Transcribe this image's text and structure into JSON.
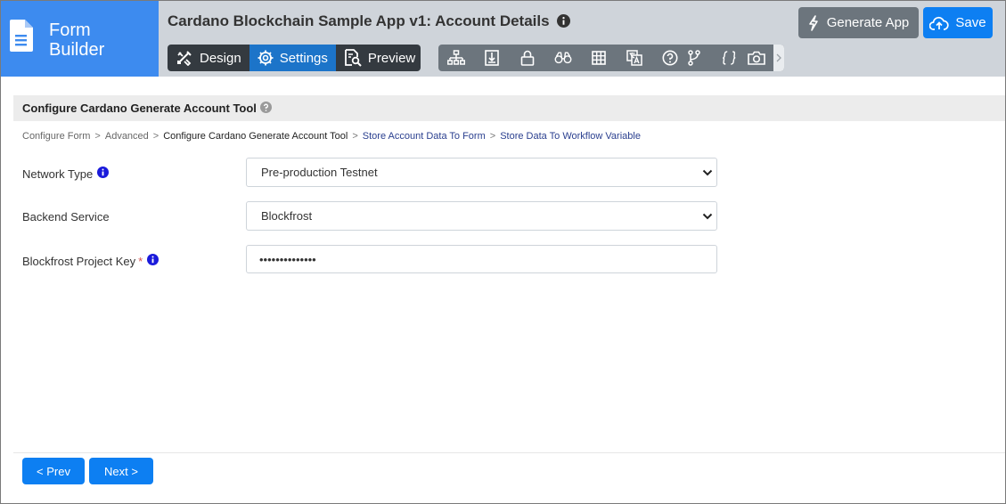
{
  "brand": {
    "line1": "Form",
    "line2": "Builder"
  },
  "app": {
    "title": "Cardano Blockchain Sample App v1: Account Details"
  },
  "modes": [
    {
      "label": "Design",
      "icon": "design-tools-icon",
      "active": false
    },
    {
      "label": "Settings",
      "icon": "gear-icon",
      "active": true
    },
    {
      "label": "Preview",
      "icon": "preview-icon",
      "active": false
    }
  ],
  "toolbar_icons": [
    "sitemap-icon",
    "import-icon",
    "lock-icon",
    "binoculars-icon",
    "grid-icon",
    "translate-icon",
    "help-circle-icon",
    "branch-icon",
    "braces-icon",
    "camera-icon"
  ],
  "actions": {
    "generate": "Generate App",
    "save": "Save"
  },
  "section": {
    "title": "Configure Cardano Generate Account Tool"
  },
  "breadcrumb": [
    {
      "label": "Configure Form",
      "state": "past"
    },
    {
      "label": "Advanced",
      "state": "past"
    },
    {
      "label": "Configure Cardano Generate Account Tool",
      "state": "current"
    },
    {
      "label": "Store Account Data To Form",
      "state": "next"
    },
    {
      "label": "Store Data To Workflow Variable",
      "state": "next"
    }
  ],
  "breadcrumb_separator": ">",
  "fields": {
    "network": {
      "label": "Network Type",
      "value": "Pre-production Testnet"
    },
    "backend": {
      "label": "Backend Service",
      "value": "Blockfrost"
    },
    "project_key": {
      "label": "Blockfrost Project Key",
      "required_mark": "*",
      "value": "••••••••••••••"
    }
  },
  "nav": {
    "prev": "< Prev",
    "next": "Next >"
  },
  "colors": {
    "brand": "#3d8bef",
    "header": "#cfd4da",
    "primary": "#0d7ff2",
    "secondary": "#6c757d",
    "dark": "#343a40",
    "active_mode": "#1c74c9",
    "info": "#1a1adb"
  }
}
